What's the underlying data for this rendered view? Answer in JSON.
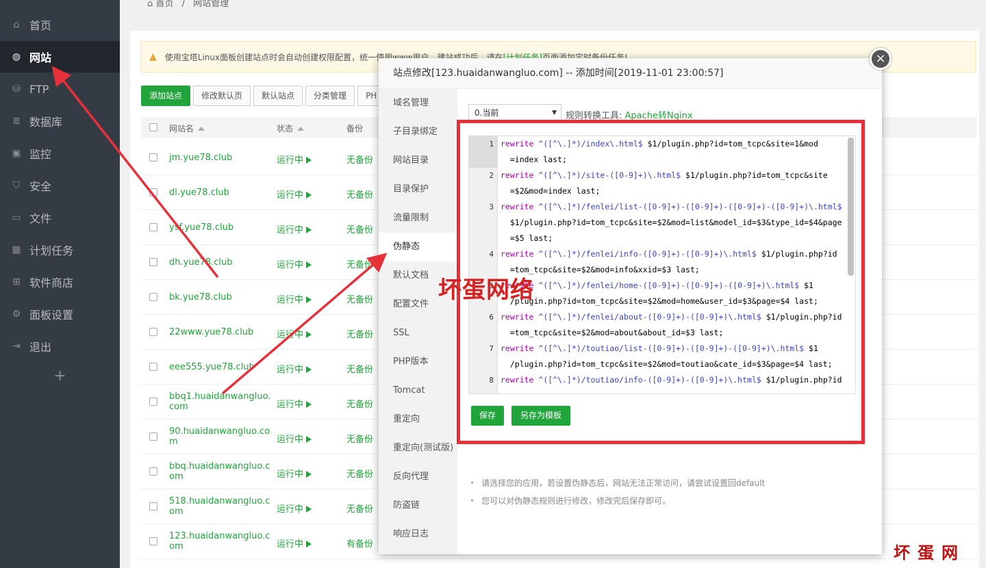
{
  "sidebar": {
    "items": [
      {
        "label": "首页",
        "icon": "home-icon"
      },
      {
        "label": "网站",
        "icon": "globe-icon"
      },
      {
        "label": "FTP",
        "icon": "ftp-icon"
      },
      {
        "label": "数据库",
        "icon": "database-icon"
      },
      {
        "label": "监控",
        "icon": "monitor-icon"
      },
      {
        "label": "安全",
        "icon": "shield-icon"
      },
      {
        "label": "文件",
        "icon": "folder-icon"
      },
      {
        "label": "计划任务",
        "icon": "calendar-icon"
      },
      {
        "label": "软件商店",
        "icon": "grid-icon"
      },
      {
        "label": "面板设置",
        "icon": "gear-icon"
      },
      {
        "label": "退出",
        "icon": "logout-icon"
      }
    ],
    "active_index": 1,
    "add": "+"
  },
  "breadcrumb": {
    "home": "首页",
    "sep": "/",
    "current": "网站管理"
  },
  "notice": {
    "text_before": "使用宝塔Linux面板创建站点时会自动创建权限配置，统一使用www用户。建站成功后，请在",
    "link": "[计划任务]",
    "text_after": "页面添加定时备份任务!"
  },
  "toolbar": {
    "add_site": "添加站点",
    "edit_default_page": "修改默认页",
    "default_site": "默认站点",
    "category": "分类管理",
    "php": "PH"
  },
  "table": {
    "headers": {
      "name": "网站名",
      "status": "状态",
      "backup": "备份"
    },
    "rows": [
      {
        "site": "jm.yue78.club",
        "status": "运行中",
        "backup": "无备份"
      },
      {
        "site": "dl.yue78.club",
        "status": "运行中",
        "backup": "无备份"
      },
      {
        "site": "ysf.yue78.club",
        "status": "运行中",
        "backup": "无备份"
      },
      {
        "site": "dh.yue78.club",
        "status": "运行中",
        "backup": "无备份"
      },
      {
        "site": "bk.yue78.club",
        "status": "运行中",
        "backup": "无备份"
      },
      {
        "site": "22www.yue78.club",
        "status": "运行中",
        "backup": "无备份"
      },
      {
        "site": "eee555.yue78.club",
        "status": "运行中",
        "backup": "无备份"
      },
      {
        "site": "bbq1.huaidanwangluo.com",
        "status": "运行中",
        "backup": "无备份"
      },
      {
        "site": "90.huaidanwangluo.com",
        "status": "运行中",
        "backup": "无备份"
      },
      {
        "site": "bbq.huaidanwangluo.com",
        "status": "运行中",
        "backup": "无备份"
      },
      {
        "site": "518.huaidanwangluo.com",
        "status": "运行中",
        "backup": "无备份"
      },
      {
        "site": "123.huaidanwangluo.com",
        "status": "运行中",
        "backup": "有备份"
      }
    ]
  },
  "modal": {
    "title": "站点修改[123.huaidanwangluo.com] -- 添加时间[2019-11-01 23:00:57]",
    "close": "×",
    "nav": [
      "域名管理",
      "子目录绑定",
      "网站目录",
      "目录保护",
      "流量限制",
      "伪静态",
      "默认文档",
      "配置文件",
      "SSL",
      "PHP版本",
      "Tomcat",
      "重定向",
      "重定向(测试版)",
      "反向代理",
      "防盗链",
      "响应日志"
    ],
    "nav_active_index": 5,
    "version_select": "0.当前",
    "rule_tool_label": "规则转换工具:",
    "rule_tool_link": "Apache转Nginx",
    "code_lines": [
      {
        "n": "1",
        "rows": [
          [
            "rewrite",
            " ^([^\\.]*)/index\\.html$",
            " $1/plugin.php?id=tom_tcpc&site=1&mod"
          ],
          [
            "",
            "",
            "  =index last;"
          ]
        ]
      },
      {
        "n": "2",
        "rows": [
          [
            "rewrite",
            " ^([^\\.]*)/site-([0-9]+)\\.html$",
            " $1/plugin.php?id=tom_tcpc&site"
          ],
          [
            "",
            "",
            "  =$2&mod=index last;"
          ]
        ]
      },
      {
        "n": "3",
        "rows": [
          [
            "rewrite",
            " ^([^\\.]*)/fenlei/list-([0-9]+)-([0-9]+)-([0-9]+)-([0-9]+)\\.html$",
            ""
          ],
          [
            "",
            "",
            "  $1/plugin.php?id=tom_tcpc&site=$2&mod=list&model_id=$3&type_id=$4&page"
          ],
          [
            "",
            "",
            "  =$5 last;"
          ]
        ]
      },
      {
        "n": "4",
        "rows": [
          [
            "rewrite",
            " ^([^\\.]*)/fenlei/info-([0-9]+)-([0-9]+)\\.html$",
            " $1/plugin.php?id"
          ],
          [
            "",
            "",
            "  =tom_tcpc&site=$2&mod=info&xxid=$3 last;"
          ]
        ]
      },
      {
        "n": "5",
        "rows": [
          [
            "rewrite",
            " ^([^\\.]*)/fenlei/home-([0-9]+)-([0-9]+)-([0-9]+)\\.html$",
            " $1"
          ],
          [
            "",
            "",
            "  /plugin.php?id=tom_tcpc&site=$2&mod=home&user_id=$3&page=$4 last;"
          ]
        ]
      },
      {
        "n": "6",
        "rows": [
          [
            "rewrite",
            " ^([^\\.]*)/fenlei/about-([0-9]+)-([0-9]+)\\.html$",
            " $1/plugin.php?id"
          ],
          [
            "",
            "",
            "  =tom_tcpc&site=$2&mod=about&about_id=$3 last;"
          ]
        ]
      },
      {
        "n": "7",
        "rows": [
          [
            "rewrite",
            " ^([^\\.]*)/toutiao/list-([0-9]+)-([0-9]+)-([0-9]+)\\.html$",
            " $1"
          ],
          [
            "",
            "",
            "  /plugin.php?id=tom_tcpc&site=$2&mod=toutiao&cate_id=$3&page=$4 last;"
          ]
        ]
      },
      {
        "n": "8",
        "rows": [
          [
            "rewrite",
            " ^([^\\.]*)/toutiao/info-([0-9]+)-([0-9]+)\\.html$",
            " $1/plugin.php?id"
          ]
        ]
      }
    ],
    "save": "保存",
    "save_as_template": "另存为模板",
    "tips": [
      "请选择您的应用，若设置伪静态后，网站无法正常访问，请尝试设置回default",
      "您可以对伪静态规则进行修改，修改完后保存即可。"
    ]
  },
  "watermark": {
    "center": "坏蛋网络",
    "corner": "坏蛋网络"
  },
  "colors": {
    "accent": "#20a53a",
    "annotation": "#e8303a",
    "sidebar": "#343b44"
  }
}
